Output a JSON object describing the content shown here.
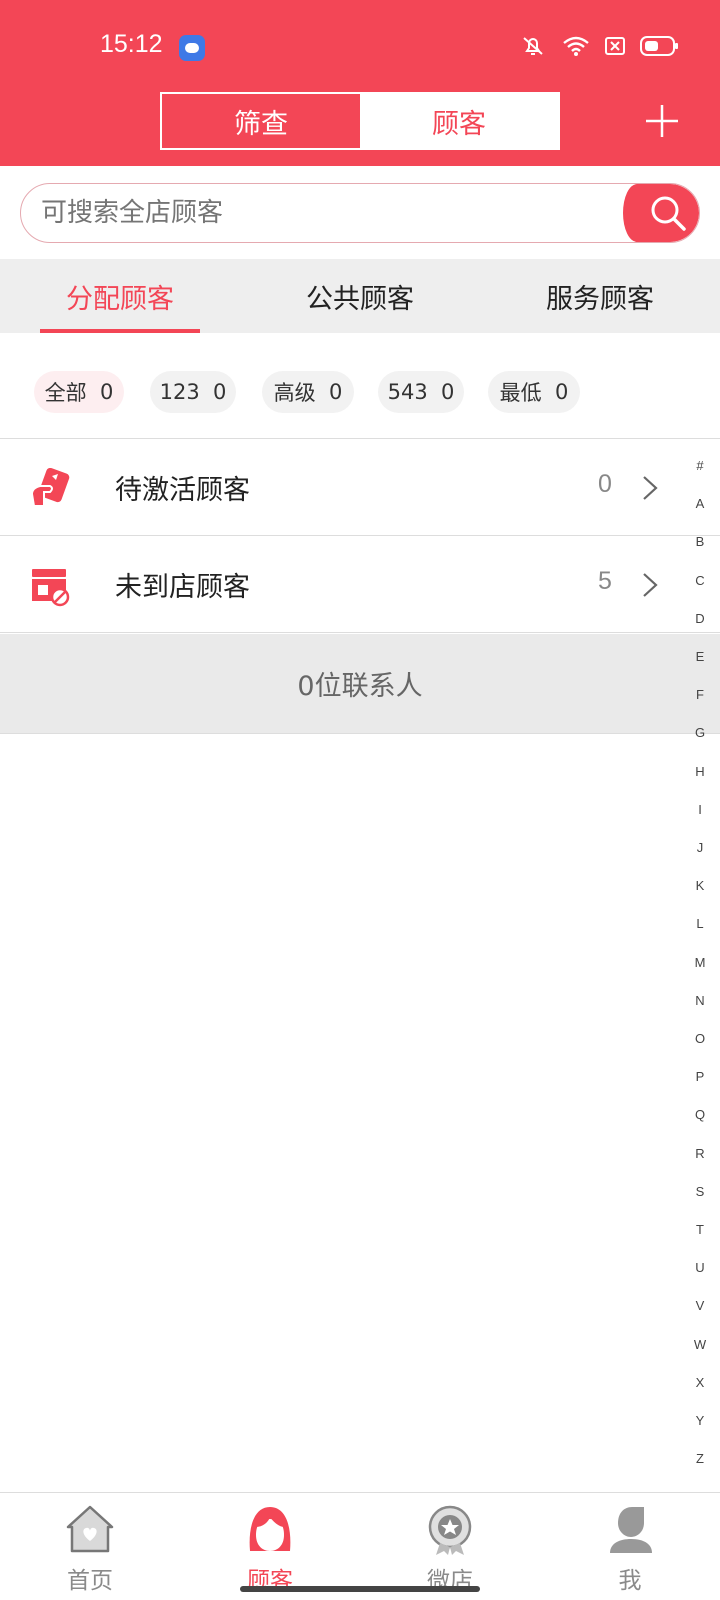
{
  "status_bar": {
    "time": "15:12"
  },
  "header": {
    "segments": [
      "筛查",
      "顾客"
    ],
    "active_segment": "顾客",
    "add_icon": "plus-icon"
  },
  "search": {
    "placeholder": "可搜索全店顾客",
    "icon": "search-icon"
  },
  "tabs": [
    {
      "label": "分配顾客",
      "active": true
    },
    {
      "label": "公共顾客",
      "active": false
    },
    {
      "label": "服务顾客",
      "active": false
    }
  ],
  "filters": [
    {
      "label": "全部",
      "count": "0",
      "active": true
    },
    {
      "label": "123",
      "count": "0",
      "active": false
    },
    {
      "label": "高级",
      "count": "0",
      "active": false
    },
    {
      "label": "543",
      "count": "0",
      "active": false
    },
    {
      "label": "最低",
      "count": "0",
      "active": false
    }
  ],
  "list": [
    {
      "label": "待激活顾客",
      "count": "0",
      "icon": "activate-icon"
    },
    {
      "label": "未到店顾客",
      "count": "5",
      "icon": "store-icon"
    }
  ],
  "contacts_summary": "0位联系人",
  "alpha_index": [
    "#",
    "A",
    "B",
    "C",
    "D",
    "E",
    "F",
    "G",
    "H",
    "I",
    "J",
    "K",
    "L",
    "M",
    "N",
    "O",
    "P",
    "Q",
    "R",
    "S",
    "T",
    "U",
    "V",
    "W",
    "X",
    "Y",
    "Z"
  ],
  "bottom_nav": [
    {
      "label": "首页",
      "icon": "home-icon",
      "active": false
    },
    {
      "label": "顾客",
      "icon": "customer-icon",
      "active": true
    },
    {
      "label": "微店",
      "icon": "shop-badge-icon",
      "active": false
    },
    {
      "label": "我",
      "icon": "profile-icon",
      "active": false
    }
  ],
  "colors": {
    "primary": "#f34656",
    "background": "#ffffff",
    "band": "#eaeaea",
    "text": "#222222"
  }
}
